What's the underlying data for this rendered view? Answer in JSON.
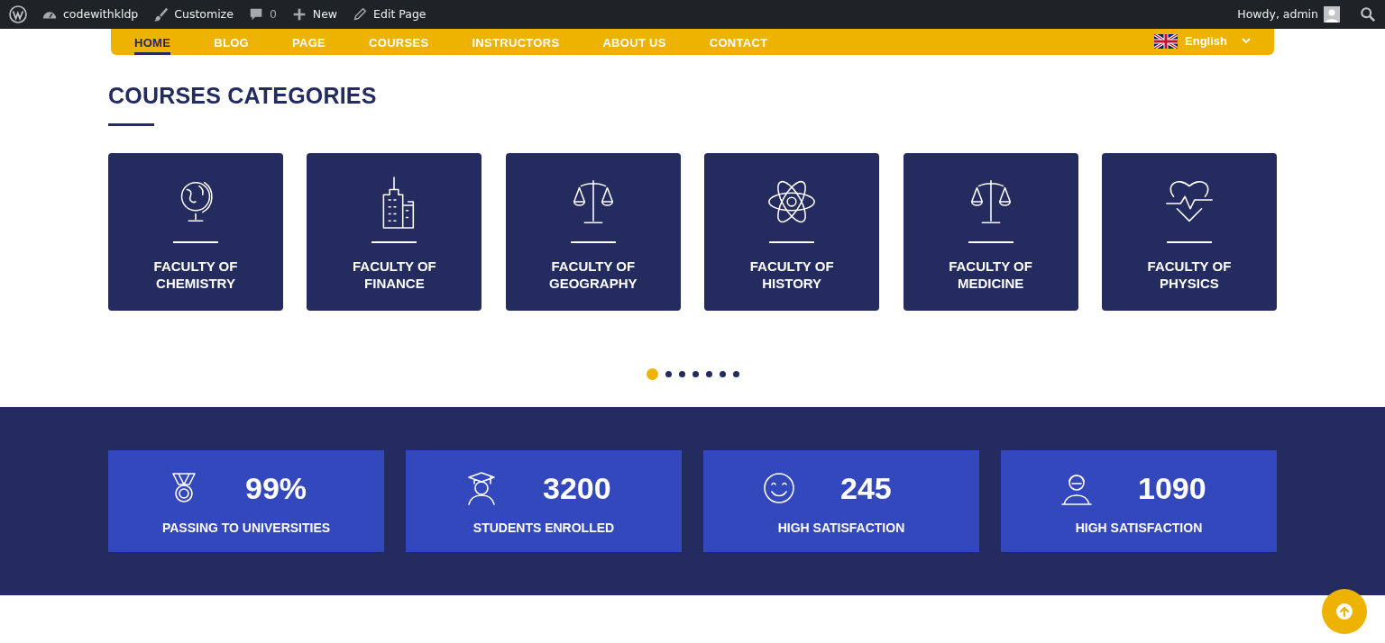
{
  "admin_bar": {
    "site": "codewithkldp",
    "customize": "Customize",
    "comments": "0",
    "new": "New",
    "edit": "Edit Page",
    "greeting": "Howdy, admin"
  },
  "nav": {
    "items": [
      {
        "label": "HOME",
        "selected": true
      },
      {
        "label": "BLOG",
        "selected": false
      },
      {
        "label": "PAGE",
        "selected": false
      },
      {
        "label": "COURSES",
        "selected": false
      },
      {
        "label": "INSTRUCTORS",
        "selected": false
      },
      {
        "label": "ABOUT US",
        "selected": false
      },
      {
        "label": "CONTACT",
        "selected": false
      }
    ],
    "language": "English"
  },
  "categories": {
    "title": "COURSES CATEGORIES",
    "items": [
      {
        "line1": "FACULTY OF",
        "line2": "CHEMISTRY"
      },
      {
        "line1": "FACULTY OF",
        "line2": "FINANCE"
      },
      {
        "line1": "FACULTY OF",
        "line2": "GEOGRAPHY"
      },
      {
        "line1": "FACULTY OF",
        "line2": "HISTORY"
      },
      {
        "line1": "FACULTY OF",
        "line2": "MEDICINE"
      },
      {
        "line1": "FACULTY OF",
        "line2": "PHYSICS"
      }
    ],
    "dots": [
      {
        "selected": true
      },
      {
        "selected": false
      },
      {
        "selected": false
      },
      {
        "selected": false
      },
      {
        "selected": false
      },
      {
        "selected": false
      },
      {
        "selected": false
      }
    ]
  },
  "stats": [
    {
      "value": "99%",
      "label": "PASSING TO UNIVERSITIES"
    },
    {
      "value": "3200",
      "label": "STUDENTS ENROLLED"
    },
    {
      "value": "245",
      "label": "HIGH SATISFACTION"
    },
    {
      "value": "1090",
      "label": "HIGH SATISFACTION"
    }
  ]
}
